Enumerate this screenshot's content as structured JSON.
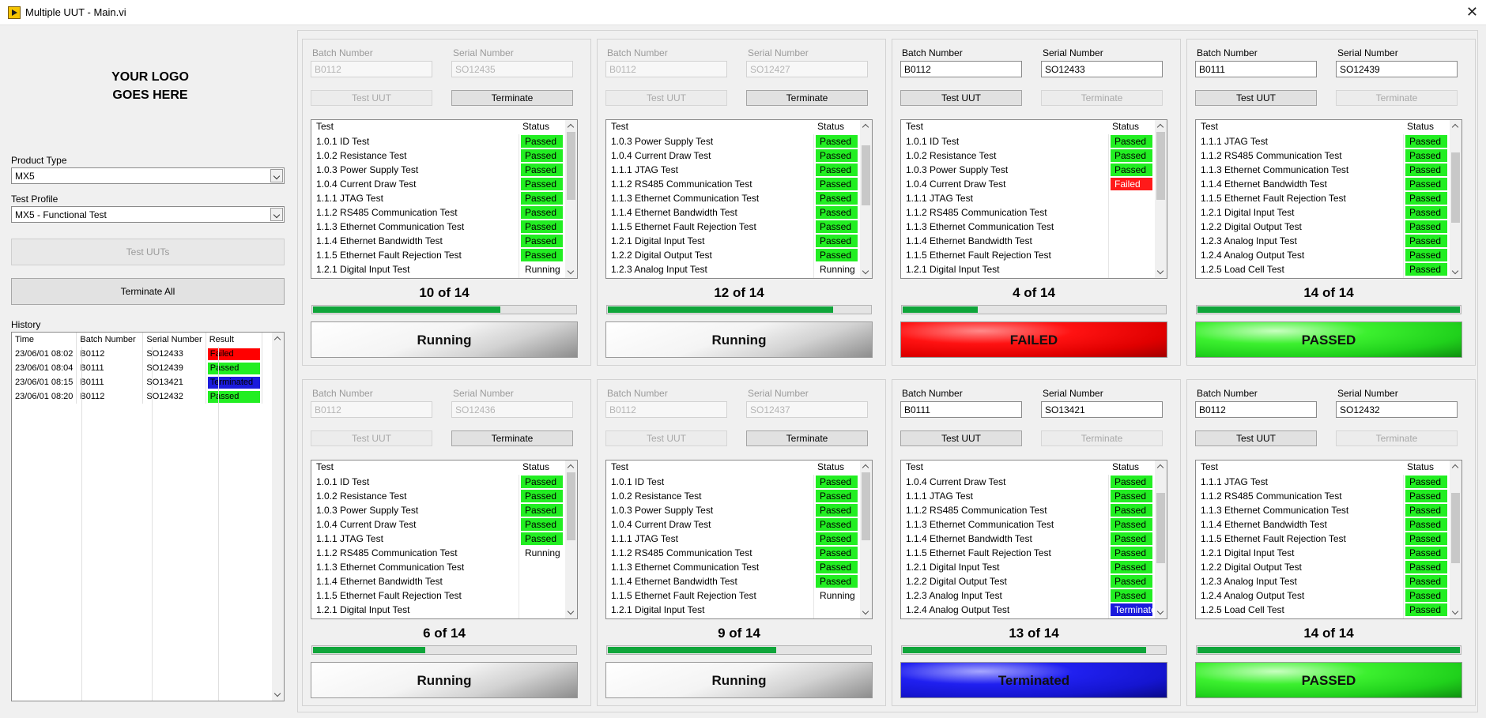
{
  "window": {
    "title": "Multiple UUT - Main.vi",
    "close": "✕"
  },
  "left": {
    "logo_line1": "YOUR LOGO",
    "logo_line2": "GOES HERE",
    "product_type_label": "Product Type",
    "product_type_value": "MX5",
    "test_profile_label": "Test Profile",
    "test_profile_value": "MX5 - Functional Test",
    "test_uuts_label": "Test UUTs",
    "terminate_all_label": "Terminate All",
    "history_label": "History",
    "history_columns": [
      "Time",
      "Batch Number",
      "Serial Number",
      "Result"
    ],
    "history_rows": [
      {
        "time": "23/06/01 08:02",
        "batch": "B0112",
        "serial": "SO12433",
        "result": "Failed",
        "color": "#ff0000"
      },
      {
        "time": "23/06/01 08:04",
        "batch": "B0111",
        "serial": "SO12439",
        "result": "Passed",
        "color": "#22ee22"
      },
      {
        "time": "23/06/01 08:15",
        "batch": "B0111",
        "serial": "SO13421",
        "result": "Terminated",
        "color": "#1b1bdc"
      },
      {
        "time": "23/06/01 08:20",
        "batch": "B0112",
        "serial": "SO12432",
        "result": "Passed",
        "color": "#22ee22"
      }
    ]
  },
  "colors": {
    "passed": "#22ee22",
    "failed": "#ff1a1a",
    "terminated": "#1b1bdc",
    "progress": "#0fa53a"
  },
  "uut_labels": {
    "batch": "Batch Number",
    "serial": "Serial Number",
    "test": "Test UUT",
    "terminate": "Terminate",
    "col_test": "Test",
    "col_status": "Status"
  },
  "uuts": [
    {
      "batch": "B0112",
      "serial": "SO12435",
      "running": true,
      "count": "10 of 14",
      "progress": 0.714,
      "result": "Running",
      "result_style": "running",
      "thumb": [
        0.0,
        0.82
      ],
      "rows": [
        [
          "1.0.1 ID Test",
          "Passed"
        ],
        [
          "1.0.2 Resistance Test",
          "Passed"
        ],
        [
          "1.0.3 Power Supply Test",
          "Passed"
        ],
        [
          "1.0.4 Current Draw Test",
          "Passed"
        ],
        [
          "1.1.1 JTAG Test",
          "Passed"
        ],
        [
          "1.1.2 RS485 Communication Test",
          "Passed"
        ],
        [
          "1.1.3 Ethernet Communication Test",
          "Passed"
        ],
        [
          "1.1.4 Ethernet Bandwidth Test",
          "Passed"
        ],
        [
          "1.1.5 Ethernet Fault Rejection Test",
          "Passed"
        ],
        [
          "1.2.1 Digital Input Test",
          "Running"
        ]
      ]
    },
    {
      "batch": "B0112",
      "serial": "SO12427",
      "running": true,
      "count": "12 of 14",
      "progress": 0.857,
      "result": "Running",
      "result_style": "running",
      "thumb": [
        0.2,
        0.82
      ],
      "rows": [
        [
          "1.0.3 Power Supply Test",
          "Passed"
        ],
        [
          "1.0.4 Current Draw Test",
          "Passed"
        ],
        [
          "1.1.1 JTAG Test",
          "Passed"
        ],
        [
          "1.1.2 RS485 Communication Test",
          "Passed"
        ],
        [
          "1.1.3 Ethernet Communication Test",
          "Passed"
        ],
        [
          "1.1.4 Ethernet Bandwidth Test",
          "Passed"
        ],
        [
          "1.1.5 Ethernet Fault Rejection Test",
          "Passed"
        ],
        [
          "1.2.1 Digital Input Test",
          "Passed"
        ],
        [
          "1.2.2 Digital Output Test",
          "Passed"
        ],
        [
          "1.2.3 Analog Input Test",
          "Running"
        ]
      ]
    },
    {
      "batch": "B0112",
      "serial": "SO12433",
      "running": false,
      "count": "4 of 14",
      "progress": 0.286,
      "result": "FAILED",
      "result_style": "failed",
      "thumb": [
        0.0,
        0.82
      ],
      "rows": [
        [
          "1.0.1 ID Test",
          "Passed"
        ],
        [
          "1.0.2 Resistance Test",
          "Passed"
        ],
        [
          "1.0.3 Power Supply Test",
          "Passed"
        ],
        [
          "1.0.4 Current Draw Test",
          "Failed"
        ],
        [
          "1.1.1 JTAG Test",
          ""
        ],
        [
          "1.1.2 RS485 Communication Test",
          ""
        ],
        [
          "1.1.3 Ethernet Communication Test",
          ""
        ],
        [
          "1.1.4 Ethernet Bandwidth Test",
          ""
        ],
        [
          "1.1.5 Ethernet Fault Rejection Test",
          ""
        ],
        [
          "1.2.1 Digital Input Test",
          ""
        ]
      ]
    },
    {
      "batch": "B0111",
      "serial": "SO12439",
      "running": false,
      "count": "14 of 14",
      "progress": 1.0,
      "result": "PASSED",
      "result_style": "passed",
      "thumb": [
        0.3,
        1.0
      ],
      "rows": [
        [
          "1.1.1 JTAG Test",
          "Passed"
        ],
        [
          "1.1.2 RS485 Communication Test",
          "Passed"
        ],
        [
          "1.1.3 Ethernet Communication Test",
          "Passed"
        ],
        [
          "1.1.4 Ethernet Bandwidth Test",
          "Passed"
        ],
        [
          "1.1.5 Ethernet Fault Rejection Test",
          "Passed"
        ],
        [
          "1.2.1 Digital Input Test",
          "Passed"
        ],
        [
          "1.2.2 Digital Output Test",
          "Passed"
        ],
        [
          "1.2.3 Analog Input Test",
          "Passed"
        ],
        [
          "1.2.4 Analog Output Test",
          "Passed"
        ],
        [
          "1.2.5 Load Cell Test",
          "Passed"
        ]
      ]
    },
    {
      "batch": "B0112",
      "serial": "SO12436",
      "running": true,
      "count": "6 of 14",
      "progress": 0.429,
      "result": "Running",
      "result_style": "running",
      "thumb": [
        0.0,
        0.82
      ],
      "rows": [
        [
          "1.0.1 ID Test",
          "Passed"
        ],
        [
          "1.0.2 Resistance Test",
          "Passed"
        ],
        [
          "1.0.3 Power Supply Test",
          "Passed"
        ],
        [
          "1.0.4 Current Draw Test",
          "Passed"
        ],
        [
          "1.1.1 JTAG Test",
          "Passed"
        ],
        [
          "1.1.2 RS485 Communication Test",
          "Running"
        ],
        [
          "1.1.3 Ethernet Communication Test",
          ""
        ],
        [
          "1.1.4 Ethernet Bandwidth Test",
          ""
        ],
        [
          "1.1.5 Ethernet Fault Rejection Test",
          ""
        ],
        [
          "1.2.1 Digital Input Test",
          ""
        ]
      ]
    },
    {
      "batch": "B0112",
      "serial": "SO12437",
      "running": true,
      "count": "9 of 14",
      "progress": 0.643,
      "result": "Running",
      "result_style": "running",
      "thumb": [
        0.0,
        0.82
      ],
      "rows": [
        [
          "1.0.1 ID Test",
          "Passed"
        ],
        [
          "1.0.2 Resistance Test",
          "Passed"
        ],
        [
          "1.0.3 Power Supply Test",
          "Passed"
        ],
        [
          "1.0.4 Current Draw Test",
          "Passed"
        ],
        [
          "1.1.1 JTAG Test",
          "Passed"
        ],
        [
          "1.1.2 RS485 Communication Test",
          "Passed"
        ],
        [
          "1.1.3 Ethernet Communication Test",
          "Passed"
        ],
        [
          "1.1.4 Ethernet Bandwidth Test",
          "Passed"
        ],
        [
          "1.1.5 Ethernet Fault Rejection Test",
          "Running"
        ],
        [
          "1.2.1 Digital Input Test",
          ""
        ]
      ]
    },
    {
      "batch": "B0111",
      "serial": "SO13421",
      "running": false,
      "count": "13 of 14",
      "progress": 0.929,
      "result": "Terminated",
      "result_style": "terminated",
      "thumb": [
        0.3,
        1.0
      ],
      "rows": [
        [
          "1.0.4 Current Draw Test",
          "Passed"
        ],
        [
          "1.1.1 JTAG Test",
          "Passed"
        ],
        [
          "1.1.2 RS485 Communication Test",
          "Passed"
        ],
        [
          "1.1.3 Ethernet Communication Test",
          "Passed"
        ],
        [
          "1.1.4 Ethernet Bandwidth Test",
          "Passed"
        ],
        [
          "1.1.5 Ethernet Fault Rejection Test",
          "Passed"
        ],
        [
          "1.2.1 Digital Input Test",
          "Passed"
        ],
        [
          "1.2.2 Digital Output Test",
          "Passed"
        ],
        [
          "1.2.3 Analog Input Test",
          "Passed"
        ],
        [
          "1.2.4 Analog Output Test",
          "Terminated"
        ]
      ]
    },
    {
      "batch": "B0112",
      "serial": "SO12432",
      "running": false,
      "count": "14 of 14",
      "progress": 1.0,
      "result": "PASSED",
      "result_style": "passed",
      "thumb": [
        0.3,
        1.0
      ],
      "rows": [
        [
          "1.1.1 JTAG Test",
          "Passed"
        ],
        [
          "1.1.2 RS485 Communication Test",
          "Passed"
        ],
        [
          "1.1.3 Ethernet Communication Test",
          "Passed"
        ],
        [
          "1.1.4 Ethernet Bandwidth Test",
          "Passed"
        ],
        [
          "1.1.5 Ethernet Fault Rejection Test",
          "Passed"
        ],
        [
          "1.2.1 Digital Input Test",
          "Passed"
        ],
        [
          "1.2.2 Digital Output Test",
          "Passed"
        ],
        [
          "1.2.3 Analog Input Test",
          "Passed"
        ],
        [
          "1.2.4 Analog Output Test",
          "Passed"
        ],
        [
          "1.2.5 Load Cell Test",
          "Passed"
        ]
      ]
    }
  ]
}
